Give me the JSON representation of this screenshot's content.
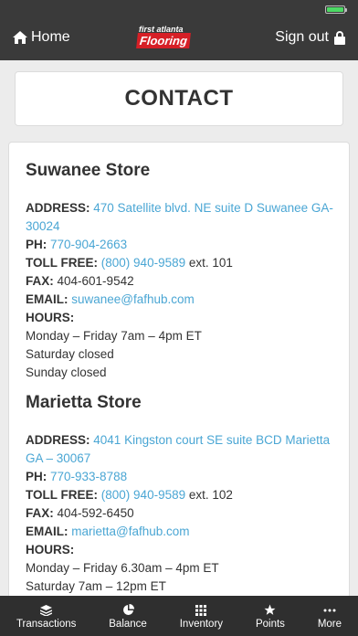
{
  "colors": {
    "bar_bg": "#3a3a3a",
    "link": "#4aa6d4",
    "logo_red": "#d61f26",
    "battery": "#4cd964"
  },
  "header": {
    "home_label": "Home",
    "signout_label": "Sign out",
    "logo_line1": "first atlanta",
    "logo_line2": "Flooring",
    "home_icon": "home-icon",
    "lock_icon": "lock-icon"
  },
  "page": {
    "title": "CONTACT"
  },
  "stores": [
    {
      "name": "Suwanee Store",
      "address_label": "ADDRESS:",
      "address": "470 Satellite blvd. NE suite D Suwanee GA-30024",
      "ph_label": "PH:",
      "phone": "770-904-2663",
      "tollfree_label": "TOLL FREE:",
      "tollfree": "(800) 940-9589",
      "tollfree_ext": " ext. 101",
      "fax_label": "FAX:",
      "fax": " 404-601-9542",
      "email_label": "EMAIL:",
      "email": "suwanee@fafhub.com",
      "hours_label": "HOURS:",
      "hours": [
        "Monday – Friday 7am – 4pm ET",
        "Saturday closed",
        "Sunday closed"
      ]
    },
    {
      "name": "Marietta Store",
      "address_label": "ADDRESS:",
      "address": "4041 Kingston court SE suite BCD Marietta GA – 30067",
      "ph_label": "PH:",
      "phone": "770-933-8788",
      "tollfree_label": "TOLL FREE:",
      "tollfree": "(800) 940-9589",
      "tollfree_ext": " ext. 102",
      "fax_label": "FAX:",
      "fax": " 404-592-6450",
      "email_label": "EMAIL:",
      "email": "marietta@fafhub.com",
      "hours_label": "HOURS:",
      "hours": [
        "Monday – Friday 6.30am – 4pm ET",
        "Saturday 7am – 12pm ET"
      ]
    }
  ],
  "tabs": [
    {
      "label": "Transactions",
      "icon": "layers-icon"
    },
    {
      "label": "Balance",
      "icon": "pie-chart-icon"
    },
    {
      "label": "Inventory",
      "icon": "grid-icon"
    },
    {
      "label": "Points",
      "icon": "star-icon"
    },
    {
      "label": "More",
      "icon": "more-dots-icon"
    }
  ]
}
